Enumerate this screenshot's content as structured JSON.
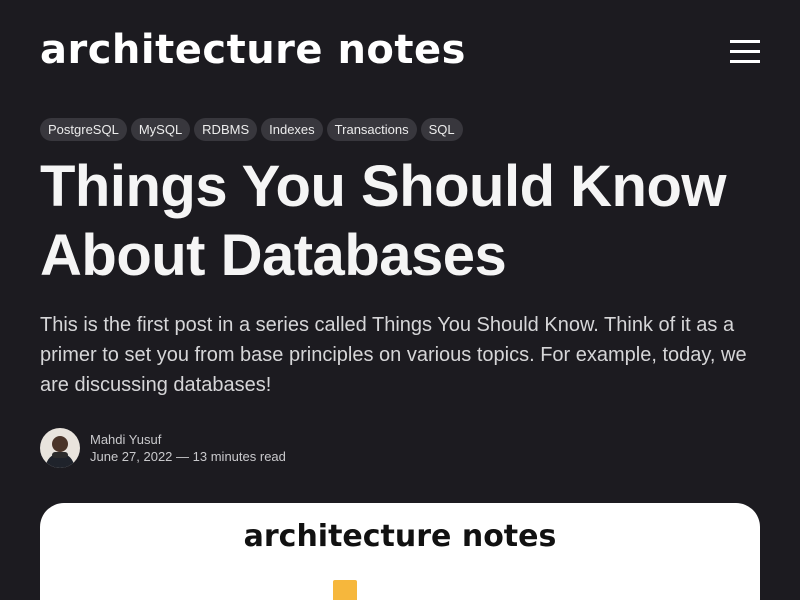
{
  "site": {
    "logo_text": "architecture notes"
  },
  "header": {
    "menu_icon": "hamburger-menu-icon"
  },
  "article": {
    "tags": [
      "PostgreSQL",
      "MySQL",
      "RDBMS",
      "Indexes",
      "Transactions",
      "SQL"
    ],
    "title": "Things You Should Know About Databases",
    "excerpt": "This is the first post in a series called Things You Should Know. Think of it as a primer to set you from base principles on various topics. For example, today, we are discussing databases!",
    "author": {
      "name": "Mahdi Yusuf",
      "date": "June 27, 2022",
      "separator": "—",
      "read_time": "13 minutes read"
    },
    "feature_image": {
      "logo_text": "architecture notes",
      "accent_color": "#f6b73c"
    }
  },
  "colors": {
    "background": "#1c1b20",
    "tag_background": "#38373d",
    "text": "#f5f5f5"
  }
}
